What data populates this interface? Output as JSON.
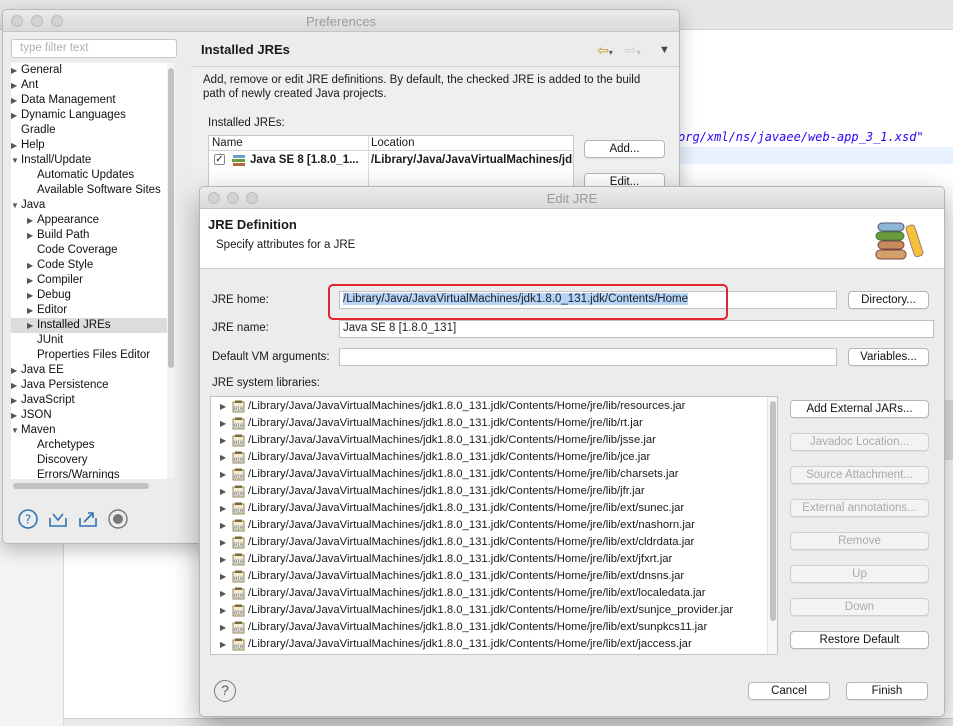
{
  "background": {
    "code_text": "org/xml/ns/javaee/web-app_3_1.xsd\""
  },
  "preferences": {
    "title": "Preferences",
    "filter_placeholder": "type filter text",
    "tree": [
      {
        "label": "General",
        "expandable": true,
        "expanded": false,
        "level": 0
      },
      {
        "label": "Ant",
        "expandable": true,
        "expanded": false,
        "level": 0
      },
      {
        "label": "Data Management",
        "expandable": true,
        "expanded": false,
        "level": 0
      },
      {
        "label": "Dynamic Languages",
        "expandable": true,
        "expanded": false,
        "level": 0
      },
      {
        "label": "Gradle",
        "expandable": false,
        "level": 0
      },
      {
        "label": "Help",
        "expandable": true,
        "expanded": false,
        "level": 0
      },
      {
        "label": "Install/Update",
        "expandable": true,
        "expanded": true,
        "level": 0
      },
      {
        "label": "Automatic Updates",
        "expandable": false,
        "level": 1
      },
      {
        "label": "Available Software Sites",
        "expandable": false,
        "level": 1
      },
      {
        "label": "Java",
        "expandable": true,
        "expanded": true,
        "level": 0
      },
      {
        "label": "Appearance",
        "expandable": true,
        "expanded": false,
        "level": 1
      },
      {
        "label": "Build Path",
        "expandable": true,
        "expanded": false,
        "level": 1
      },
      {
        "label": "Code Coverage",
        "expandable": false,
        "level": 1
      },
      {
        "label": "Code Style",
        "expandable": true,
        "expanded": false,
        "level": 1
      },
      {
        "label": "Compiler",
        "expandable": true,
        "expanded": false,
        "level": 1
      },
      {
        "label": "Debug",
        "expandable": true,
        "expanded": false,
        "level": 1
      },
      {
        "label": "Editor",
        "expandable": true,
        "expanded": false,
        "level": 1
      },
      {
        "label": "Installed JREs",
        "expandable": true,
        "expanded": false,
        "level": 1,
        "selected": true
      },
      {
        "label": "JUnit",
        "expandable": false,
        "level": 1
      },
      {
        "label": "Properties Files Editor",
        "expandable": false,
        "level": 1
      },
      {
        "label": "Java EE",
        "expandable": true,
        "expanded": false,
        "level": 0
      },
      {
        "label": "Java Persistence",
        "expandable": true,
        "expanded": false,
        "level": 0
      },
      {
        "label": "JavaScript",
        "expandable": true,
        "expanded": false,
        "level": 0
      },
      {
        "label": "JSON",
        "expandable": true,
        "expanded": false,
        "level": 0
      },
      {
        "label": "Maven",
        "expandable": true,
        "expanded": true,
        "level": 0
      },
      {
        "label": "Archetypes",
        "expandable": false,
        "level": 1
      },
      {
        "label": "Discovery",
        "expandable": false,
        "level": 1
      },
      {
        "label": "Errors/Warnings",
        "expandable": false,
        "level": 1
      }
    ],
    "bottom_icons": [
      "help-icon",
      "import-icon",
      "export-icon",
      "record-icon"
    ],
    "pane": {
      "title": "Installed JREs",
      "description": "Add, remove or edit JRE definitions. By default, the checked JRE is added to the build path of newly created Java projects.",
      "installed_label": "Installed JREs:",
      "columns": [
        "Name",
        "Location"
      ],
      "row": {
        "name": "Java SE 8 [1.8.0_1...",
        "location": "/Library/Java/JavaVirtualMachines/jdk",
        "checked": true
      },
      "buttons": {
        "add": "Add...",
        "edit": "Edit..."
      }
    }
  },
  "dialog": {
    "title": "Edit JRE",
    "header_title": "JRE Definition",
    "header_subtitle": "Specify attributes for a JRE",
    "jre_home_label": "JRE home:",
    "jre_home_value": "/Library/Java/JavaVirtualMachines/jdk1.8.0_131.jdk/Contents/Home",
    "jre_name_label": "JRE name:",
    "jre_name_value": "Java SE 8 [1.8.0_131]",
    "vm_args_label": "Default VM arguments:",
    "vm_args_value": "",
    "libraries_label": "JRE system libraries:",
    "libraries": [
      "/Library/Java/JavaVirtualMachines/jdk1.8.0_131.jdk/Contents/Home/jre/lib/resources.jar",
      "/Library/Java/JavaVirtualMachines/jdk1.8.0_131.jdk/Contents/Home/jre/lib/rt.jar",
      "/Library/Java/JavaVirtualMachines/jdk1.8.0_131.jdk/Contents/Home/jre/lib/jsse.jar",
      "/Library/Java/JavaVirtualMachines/jdk1.8.0_131.jdk/Contents/Home/jre/lib/jce.jar",
      "/Library/Java/JavaVirtualMachines/jdk1.8.0_131.jdk/Contents/Home/jre/lib/charsets.jar",
      "/Library/Java/JavaVirtualMachines/jdk1.8.0_131.jdk/Contents/Home/jre/lib/jfr.jar",
      "/Library/Java/JavaVirtualMachines/jdk1.8.0_131.jdk/Contents/Home/jre/lib/ext/sunec.jar",
      "/Library/Java/JavaVirtualMachines/jdk1.8.0_131.jdk/Contents/Home/jre/lib/ext/nashorn.jar",
      "/Library/Java/JavaVirtualMachines/jdk1.8.0_131.jdk/Contents/Home/jre/lib/ext/cldrdata.jar",
      "/Library/Java/JavaVirtualMachines/jdk1.8.0_131.jdk/Contents/Home/jre/lib/ext/jfxrt.jar",
      "/Library/Java/JavaVirtualMachines/jdk1.8.0_131.jdk/Contents/Home/jre/lib/ext/dnsns.jar",
      "/Library/Java/JavaVirtualMachines/jdk1.8.0_131.jdk/Contents/Home/jre/lib/ext/localedata.jar",
      "/Library/Java/JavaVirtualMachines/jdk1.8.0_131.jdk/Contents/Home/jre/lib/ext/sunjce_provider.jar",
      "/Library/Java/JavaVirtualMachines/jdk1.8.0_131.jdk/Contents/Home/jre/lib/ext/sunpkcs11.jar",
      "/Library/Java/JavaVirtualMachines/jdk1.8.0_131.jdk/Contents/Home/jre/lib/ext/jaccess.jar"
    ],
    "buttons": {
      "directory": "Directory...",
      "variables": "Variables...",
      "add_external_jars": "Add External JARs...",
      "javadoc_location": "Javadoc Location...",
      "source_attachment": "Source Attachment...",
      "external_annotations": "External annotations...",
      "remove": "Remove",
      "up": "Up",
      "down": "Down",
      "restore_default": "Restore Default",
      "cancel": "Cancel",
      "finish": "Finish"
    },
    "highlight_color": "#e0262a",
    "selection_color": "#b4d4f8"
  }
}
